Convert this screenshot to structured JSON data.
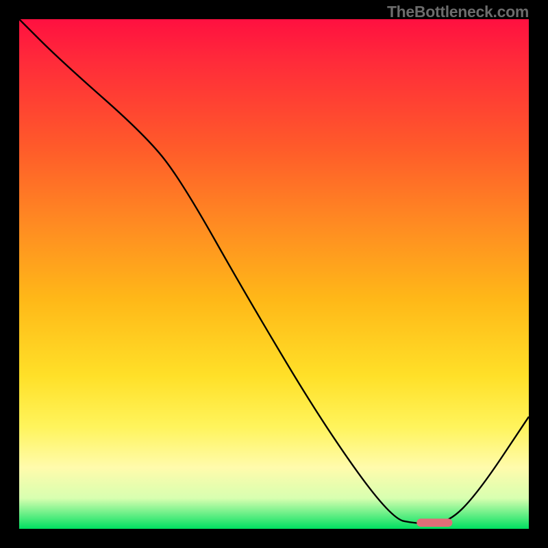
{
  "watermark": "TheBottleneck.com",
  "chart_data": {
    "type": "line",
    "title": "",
    "xlabel": "",
    "ylabel": "",
    "xlim": [
      0,
      100
    ],
    "ylim": [
      0,
      100
    ],
    "grid": false,
    "series": [
      {
        "name": "curve",
        "color": "#000000",
        "x": [
          0,
          8,
          25,
          32,
          45,
          60,
          73,
          78,
          84,
          90,
          100
        ],
        "y": [
          100,
          92,
          77,
          68,
          45,
          20,
          2,
          1,
          1,
          7,
          22
        ]
      }
    ],
    "marker": {
      "name": "optimal-segment",
      "color": "#e06e78",
      "x_start": 78,
      "x_end": 85,
      "y": 1.2,
      "thickness": 1.6
    }
  }
}
